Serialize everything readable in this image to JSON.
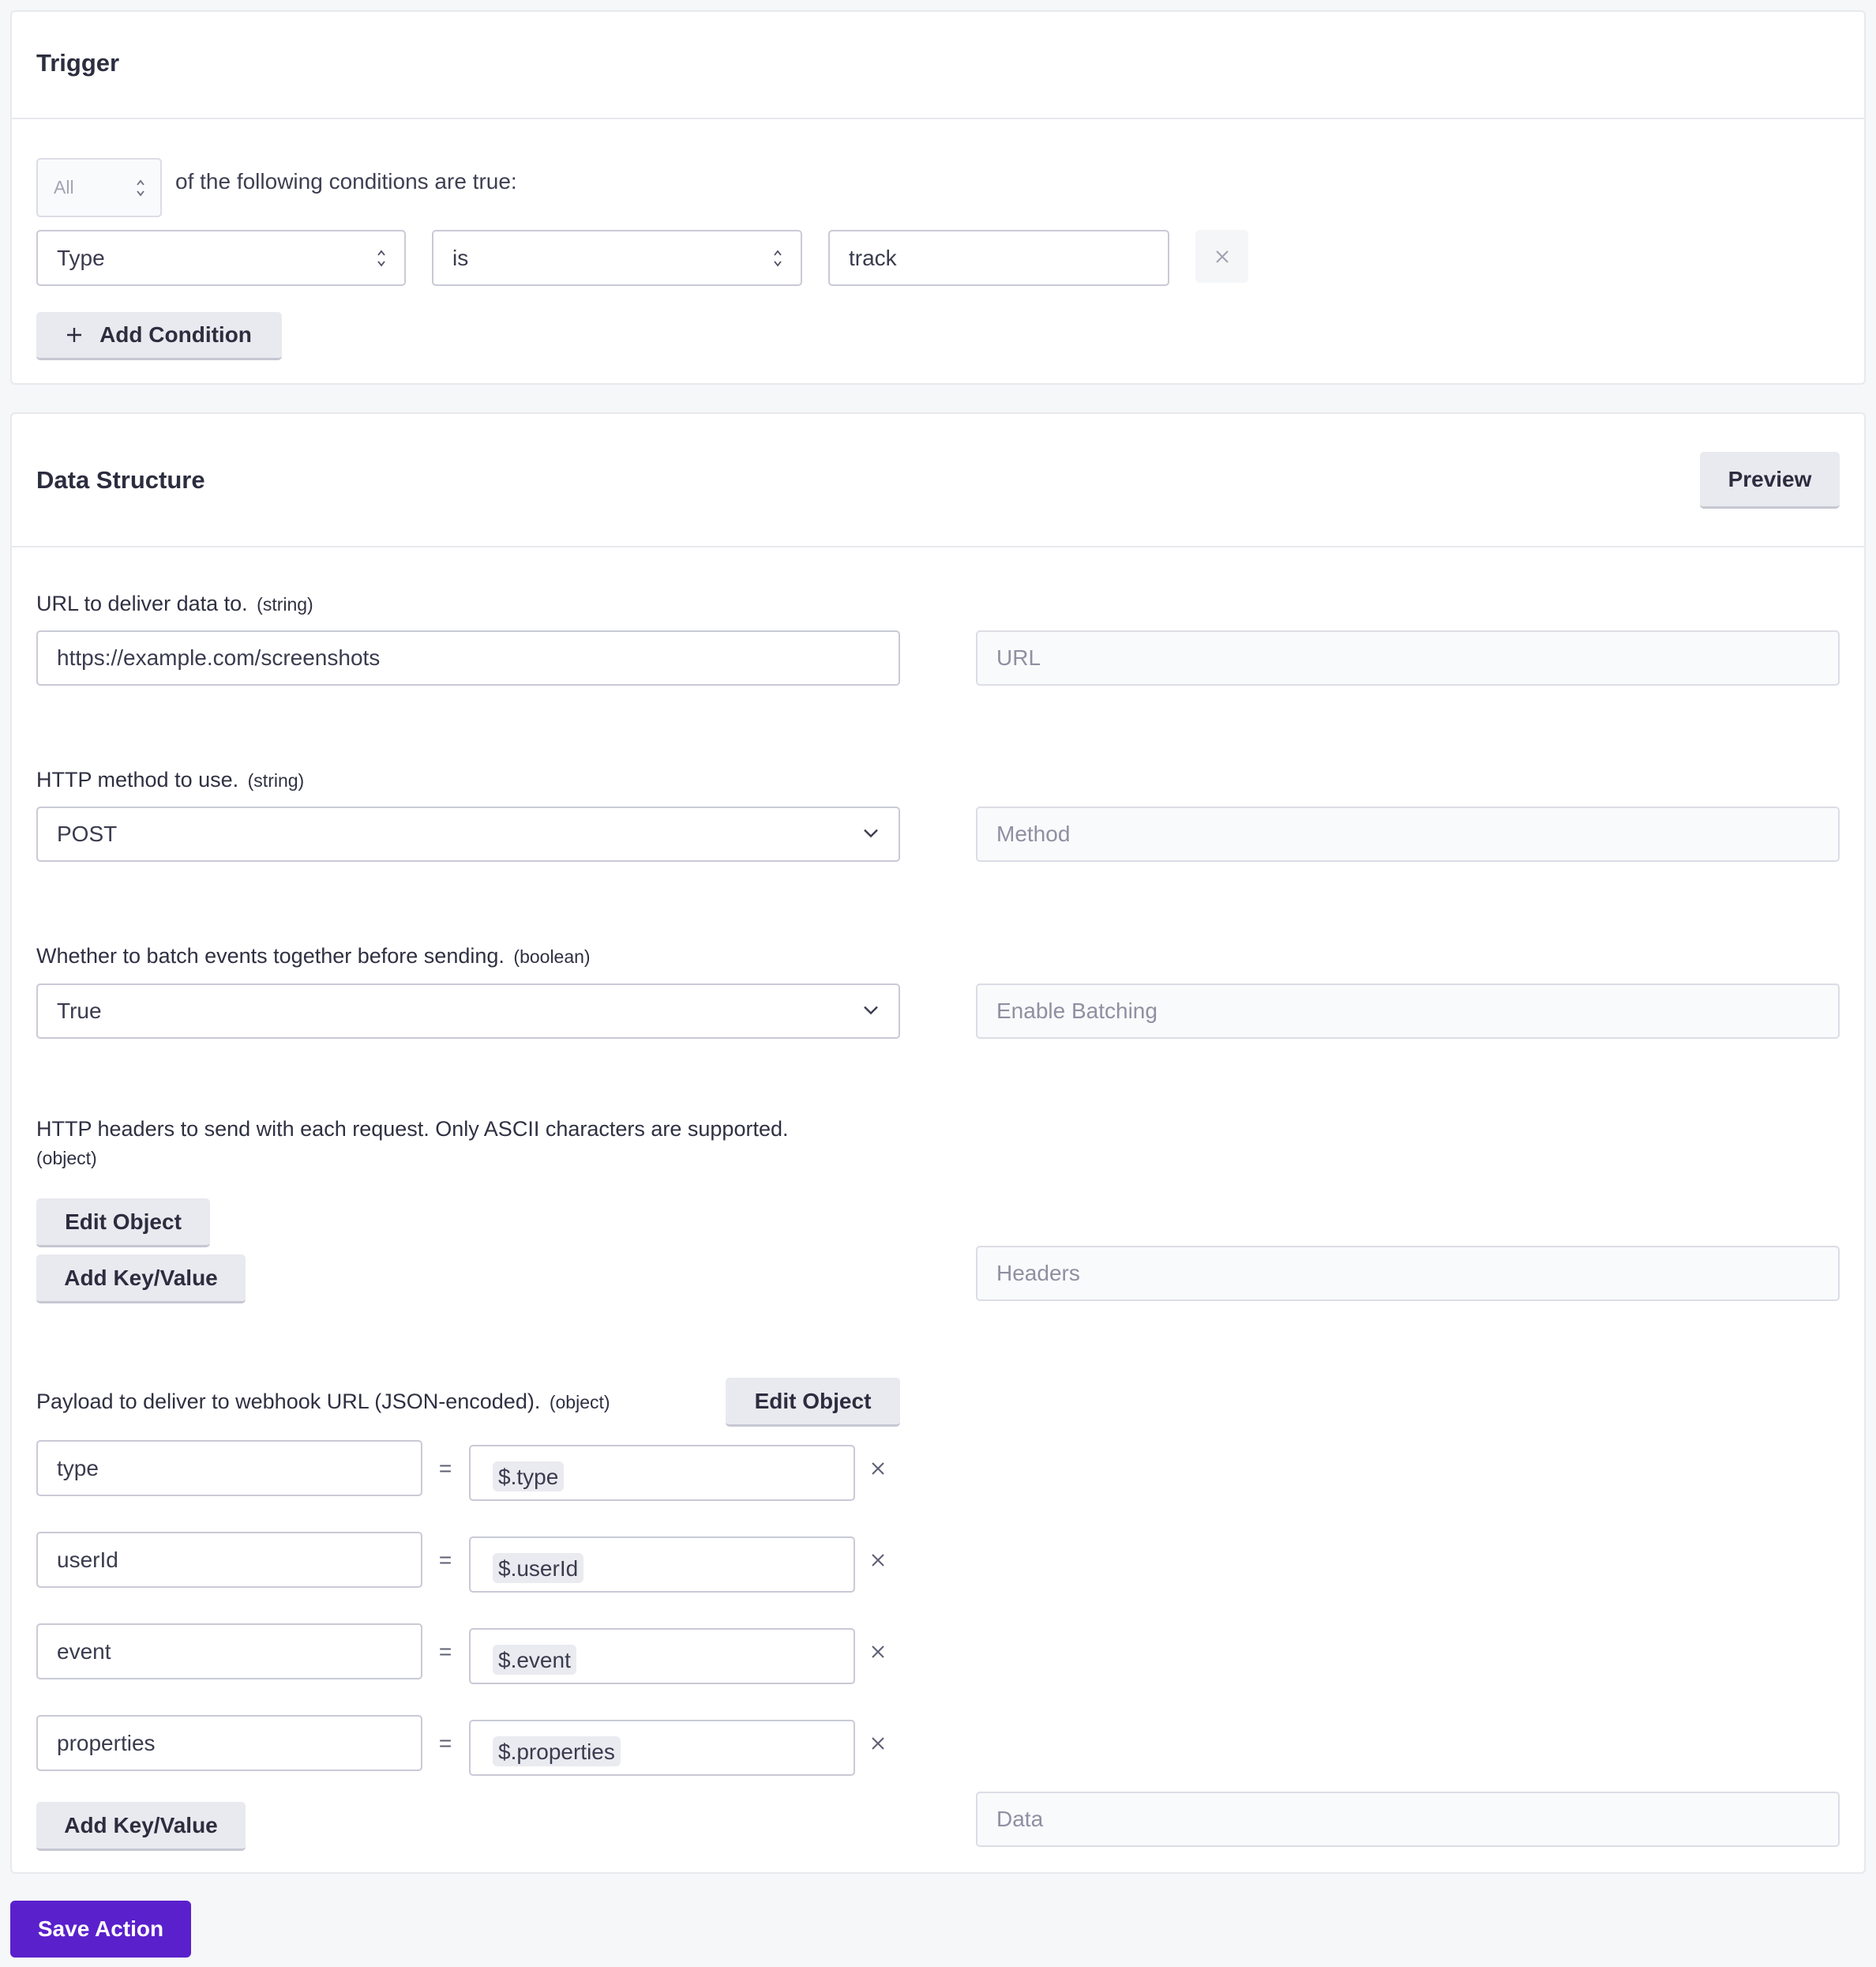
{
  "trigger": {
    "title": "Trigger",
    "match_select": "All",
    "match_text": "of the following conditions are true:",
    "conditions": [
      {
        "field": "Type",
        "operator": "is",
        "value": "track"
      }
    ],
    "add_condition_icon": "plus-icon",
    "add_condition_label": "Add Condition",
    "remove_icon": "close-icon"
  },
  "data_structure": {
    "title": "Data Structure",
    "preview_label": "Preview",
    "url": {
      "label": "URL to deliver data to.",
      "type": "(string)",
      "value": "https://example.com/screenshots",
      "mapping_placeholder": "URL"
    },
    "method": {
      "label": "HTTP method to use.",
      "type": "(string)",
      "value": "POST",
      "mapping_placeholder": "Method"
    },
    "batching": {
      "label": "Whether to batch events together before sending.",
      "type": "(boolean)",
      "value": "True",
      "mapping_placeholder": "Enable Batching"
    },
    "headers": {
      "label": "HTTP headers to send with each request. Only ASCII characters are supported.",
      "type": "(object)",
      "edit_object_label": "Edit Object",
      "add_kv_label": "Add Key/Value",
      "mapping_placeholder": "Headers"
    },
    "payload": {
      "label": "Payload to deliver to webhook URL (JSON-encoded).",
      "type": "(object)",
      "edit_object_label": "Edit Object",
      "equals": "=",
      "rows": [
        {
          "key": "type",
          "value": "$.type"
        },
        {
          "key": "userId",
          "value": "$.userId"
        },
        {
          "key": "event",
          "value": "$.event"
        },
        {
          "key": "properties",
          "value": "$.properties"
        }
      ],
      "remove_icon": "close-icon",
      "add_kv_label": "Add Key/Value",
      "mapping_placeholder": "Data"
    }
  },
  "footer": {
    "save_label": "Save Action"
  },
  "colors": {
    "primary": "#5a20cc",
    "background": "#f6f7f9",
    "button_secondary": "#e9eaef"
  }
}
